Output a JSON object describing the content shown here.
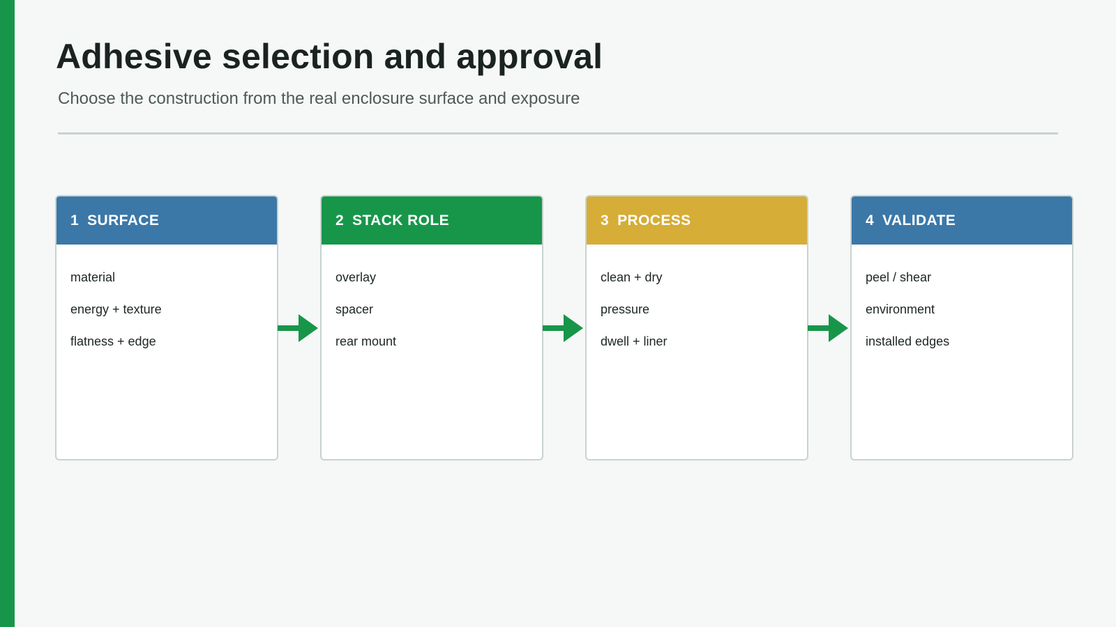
{
  "header": {
    "title": "Adhesive selection and approval",
    "subtitle": "Choose the construction from the real enclosure surface and exposure"
  },
  "colors": {
    "accent_bar": "#17964a",
    "divider": "#c8d3d1",
    "arrow": "#17964a",
    "card_border": "#c9d2d0"
  },
  "steps": [
    {
      "number": "1",
      "label": "SURFACE",
      "color": "#3b78a8",
      "items": [
        "material",
        "energy + texture",
        "flatness + edge"
      ]
    },
    {
      "number": "2",
      "label": "STACK ROLE",
      "color": "#17964a",
      "items": [
        "overlay",
        "spacer",
        "rear mount"
      ]
    },
    {
      "number": "3",
      "label": "PROCESS",
      "color": "#d6ad36",
      "items": [
        "clean + dry",
        "pressure",
        "dwell + liner"
      ]
    },
    {
      "number": "4",
      "label": "VALIDATE",
      "color": "#3b78a8",
      "items": [
        "peel / shear",
        "environment",
        "installed edges"
      ]
    }
  ],
  "connectors": [
    {
      "icon": "arrow-right-icon",
      "from": "1",
      "to": "2"
    },
    {
      "icon": "arrow-right-icon",
      "from": "2",
      "to": "3"
    },
    {
      "icon": "arrow-right-icon",
      "from": "3",
      "to": "4"
    }
  ]
}
